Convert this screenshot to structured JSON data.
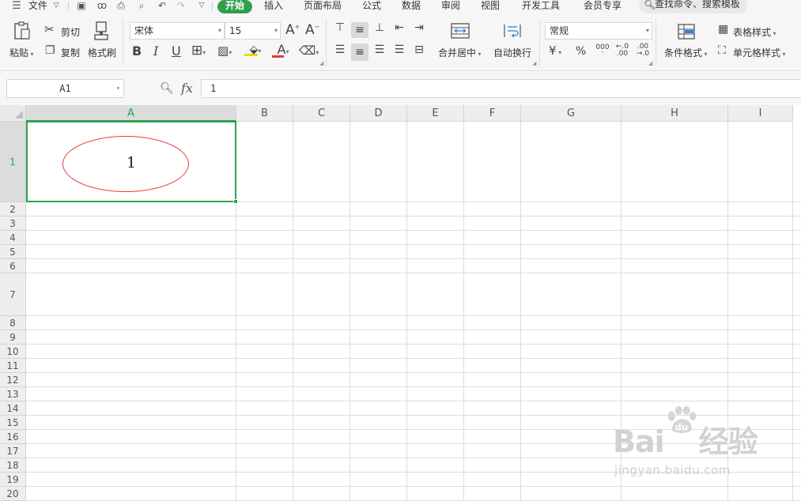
{
  "menubar": {
    "file_label": "文件",
    "tabs": [
      {
        "label": "开始",
        "active": true
      },
      {
        "label": "插入"
      },
      {
        "label": "页面布局"
      },
      {
        "label": "公式"
      },
      {
        "label": "数据"
      },
      {
        "label": "审阅"
      },
      {
        "label": "视图"
      },
      {
        "label": "开发工具"
      },
      {
        "label": "会员专享"
      }
    ],
    "search_text": "查找命令、搜索模板"
  },
  "ribbon": {
    "paste_label": "粘贴",
    "cut_label": "剪切",
    "copy_label": "复制",
    "format_painter_label": "格式刷",
    "font_name": "宋体",
    "font_size": "15",
    "bold_glyph": "B",
    "italic_glyph": "I",
    "underline_glyph": "U",
    "grow_font_glyph": "A",
    "shrink_font_glyph": "A",
    "font_color_glyph": "A",
    "merge_center_label": "合并居中",
    "wrap_text_label": "自动换行",
    "number_format": "常规",
    "currency_glyph": "¥",
    "percent_glyph": "%",
    "thousands_glyph": "000",
    "increase_decimal_glyph": ".0",
    "decrease_decimal_glyph": ".00",
    "conditional_format_label": "条件格式",
    "table_style_label": "表格样式",
    "cell_style_label": "单元格样式"
  },
  "formula_bar": {
    "name_box": "A1",
    "fx_label": "fx",
    "formula_value": "1"
  },
  "sheet": {
    "columns": [
      "A",
      "B",
      "C",
      "D",
      "E",
      "F",
      "G",
      "H",
      "I"
    ],
    "rows": [
      "1",
      "2",
      "3",
      "4",
      "5",
      "6",
      "7",
      "8",
      "9",
      "10",
      "11",
      "12",
      "13",
      "14",
      "15",
      "16",
      "17",
      "18",
      "19",
      "20"
    ],
    "selected_cell": "A1",
    "a1_value": "1",
    "accent_color": "#2fa04a",
    "oval_color": "#e53935"
  },
  "watermark": {
    "logo_text_left": "Bai",
    "logo_text_right": "经验",
    "url": "jingyan.baidu.com"
  }
}
